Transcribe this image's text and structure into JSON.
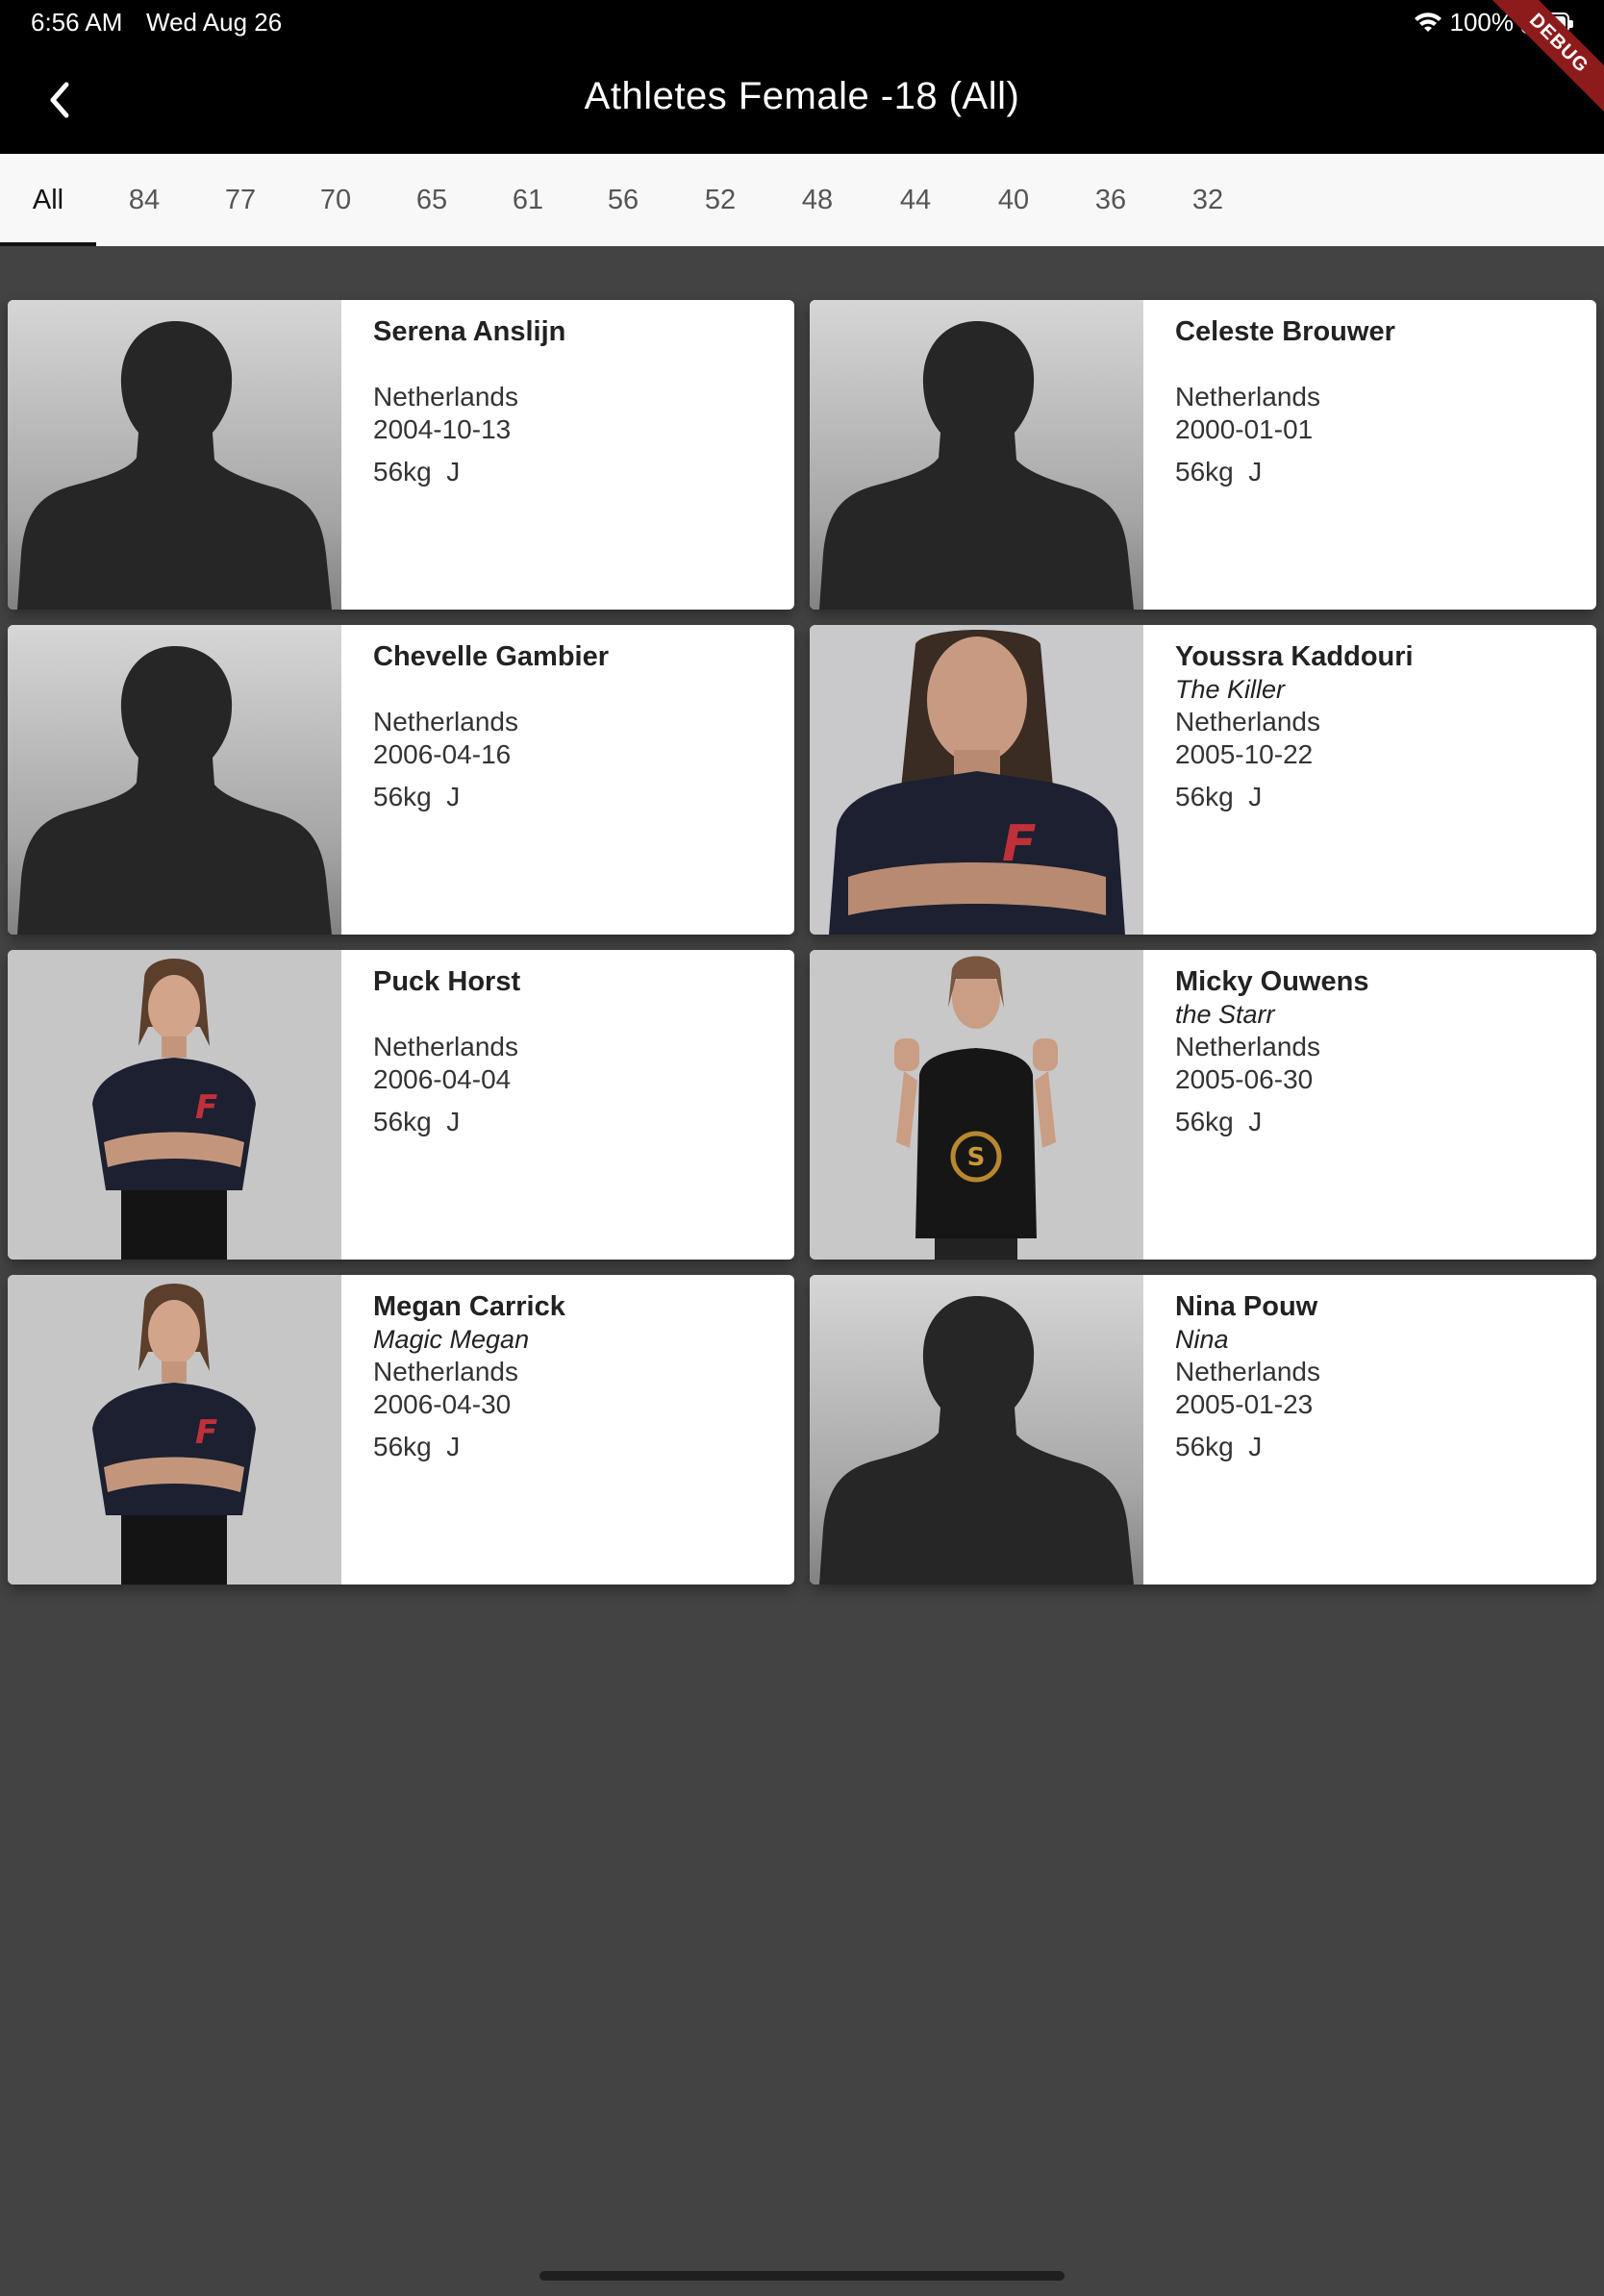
{
  "status": {
    "time": "6:56 AM",
    "date": "Wed Aug 26",
    "battery": "100%"
  },
  "debug_banner": "DEBUG",
  "appbar": {
    "title": "Athletes Female -18 (All)",
    "back_icon": "chevron-left-icon"
  },
  "tabs": [
    {
      "label": "All",
      "active": true
    },
    {
      "label": "84"
    },
    {
      "label": "77"
    },
    {
      "label": "70"
    },
    {
      "label": "65"
    },
    {
      "label": "61"
    },
    {
      "label": "56"
    },
    {
      "label": "52"
    },
    {
      "label": "48"
    },
    {
      "label": "44"
    },
    {
      "label": "40"
    },
    {
      "label": "36"
    },
    {
      "label": "32"
    }
  ],
  "athletes": [
    {
      "name": "Serena Anslijn",
      "nickname": "",
      "country": "Netherlands",
      "dob": "2004-10-13",
      "weight": "56kg  J",
      "photo": "silhouette"
    },
    {
      "name": "Celeste Brouwer",
      "nickname": "",
      "country": "Netherlands",
      "dob": "2000-01-01",
      "weight": "56kg  J",
      "photo": "silhouette"
    },
    {
      "name": "Chevelle Gambier",
      "nickname": "",
      "country": "Netherlands",
      "dob": "2006-04-16",
      "weight": "56kg  J",
      "photo": "silhouette"
    },
    {
      "name": "Youssra Kaddouri",
      "nickname": "The Killer",
      "country": "Netherlands",
      "dob": "2005-10-22",
      "weight": "56kg  J",
      "photo": "portrait-closeup"
    },
    {
      "name": "Puck Horst",
      "nickname": "",
      "country": "Netherlands",
      "dob": "2006-04-04",
      "weight": "56kg  J",
      "photo": "portrait-full"
    },
    {
      "name": "Micky Ouwens",
      "nickname": "the Starr",
      "country": "Netherlands",
      "dob": "2005-06-30",
      "weight": "56kg  J",
      "photo": "portrait-fists"
    },
    {
      "name": "Megan Carrick",
      "nickname": "Magic Megan",
      "country": "Netherlands",
      "dob": "2006-04-30",
      "weight": "56kg  J",
      "photo": "portrait-full"
    },
    {
      "name": "Nina Pouw",
      "nickname": "Nina",
      "country": "Netherlands",
      "dob": "2005-01-23",
      "weight": "56kg  J",
      "photo": "silhouette"
    }
  ]
}
